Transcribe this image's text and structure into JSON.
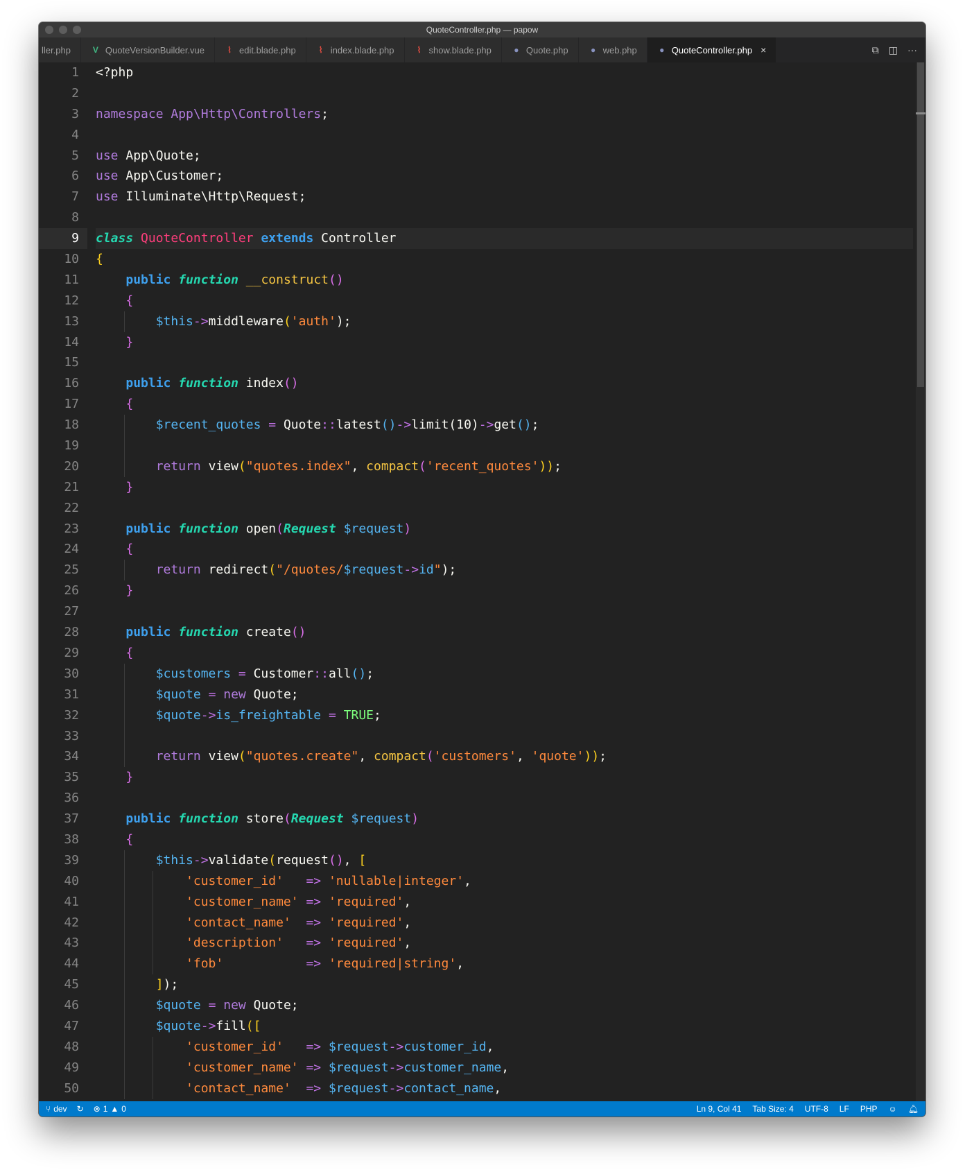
{
  "window": {
    "title": "QuoteController.php — papow"
  },
  "tabs": [
    {
      "label": "ller.php",
      "icon": "php-icon",
      "active": false
    },
    {
      "label": "QuoteVersionBuilder.vue",
      "icon": "vue-icon",
      "active": false
    },
    {
      "label": "edit.blade.php",
      "icon": "laravel-icon",
      "active": false
    },
    {
      "label": "index.blade.php",
      "icon": "laravel-icon",
      "active": false
    },
    {
      "label": "show.blade.php",
      "icon": "laravel-icon",
      "active": false
    },
    {
      "label": "Quote.php",
      "icon": "php-icon",
      "active": false
    },
    {
      "label": "web.php",
      "icon": "php-icon",
      "active": false
    },
    {
      "label": "QuoteController.php",
      "icon": "php-icon",
      "active": true
    }
  ],
  "tab_actions": {
    "close_symbol": "×",
    "more_symbol": "···"
  },
  "editor": {
    "current_line": 9,
    "line_numbers": [
      "1",
      "2",
      "3",
      "4",
      "5",
      "6",
      "7",
      "8",
      "9",
      "10",
      "11",
      "12",
      "13",
      "14",
      "15",
      "16",
      "17",
      "18",
      "19",
      "20",
      "21",
      "22",
      "23",
      "24",
      "25",
      "26",
      "27",
      "28",
      "29",
      "30",
      "31",
      "32",
      "33",
      "34",
      "35",
      "36",
      "37",
      "38",
      "39",
      "40",
      "41",
      "42",
      "43",
      "44",
      "45",
      "46",
      "47",
      "48",
      "49",
      "50"
    ]
  },
  "code": {
    "l1": {
      "a": "<?php"
    },
    "l3": {
      "a": "namespace",
      "b": " App\\Http\\Controllers",
      "c": ";"
    },
    "l5": {
      "a": "use",
      "b": " App\\Quote;"
    },
    "l6": {
      "a": "use",
      "b": " App\\Customer;"
    },
    "l7": {
      "a": "use",
      "b": " Illuminate\\Http\\Request;"
    },
    "l9": {
      "a": "class",
      "b": "QuoteController",
      "c": "extends",
      "d": "Controller"
    },
    "l10": {
      "a": "{"
    },
    "l11": {
      "a": "public",
      "b": "function",
      "c": "__construct",
      "d": "()"
    },
    "l12": {
      "a": "{"
    },
    "l13": {
      "a": "$this",
      "b": "->",
      "c": "middleware",
      "d": "(",
      "e": "'auth'",
      "f": ");"
    },
    "l14": {
      "a": "}"
    },
    "l16": {
      "a": "public",
      "b": "function",
      "c": "index",
      "d": "()"
    },
    "l17": {
      "a": "{"
    },
    "l18": {
      "a": "$recent_quotes",
      "b": " = ",
      "c": "Quote",
      "d": "::",
      "e": "latest",
      "f": "()",
      "g": "->",
      "h": "limit",
      "i": "(10)",
      "j": "->",
      "k": "get",
      "l": "()",
      "m": ";"
    },
    "l20": {
      "a": "return",
      "b": " view",
      "c": "(",
      "d": "\"quotes.index\"",
      "e": ", ",
      "f": "compact",
      "g": "(",
      "h": "'recent_quotes'",
      "i": "))",
      "j": ";"
    },
    "l21": {
      "a": "}"
    },
    "l23": {
      "a": "public",
      "b": "function",
      "c": "open",
      "d": "(",
      "e": "Request",
      "f": "$request",
      "g": ")"
    },
    "l24": {
      "a": "{"
    },
    "l25": {
      "a": "return",
      "b": " redirect",
      "c": "(",
      "d": "\"/quotes/",
      "e": "$request",
      "f": "->",
      "g": "id",
      "h": "\"",
      "i": ");"
    },
    "l26": {
      "a": "}"
    },
    "l28": {
      "a": "public",
      "b": "function",
      "c": "create",
      "d": "()"
    },
    "l29": {
      "a": "{"
    },
    "l30": {
      "a": "$customers",
      "b": " = ",
      "c": "Customer",
      "d": "::",
      "e": "all",
      "f": "()",
      "g": ";"
    },
    "l31": {
      "a": "$quote",
      "b": " = ",
      "c": "new",
      "d": " Quote;"
    },
    "l32": {
      "a": "$quote",
      "b": "->",
      "c": "is_freightable",
      "d": " = ",
      "e": "TRUE",
      "f": ";"
    },
    "l34": {
      "a": "return",
      "b": " view",
      "c": "(",
      "d": "\"quotes.create\"",
      "e": ", ",
      "f": "compact",
      "g": "(",
      "h": "'customers'",
      "i": ", ",
      "j": "'quote'",
      "k": "))",
      "l": ";"
    },
    "l35": {
      "a": "}"
    },
    "l37": {
      "a": "public",
      "b": "function",
      "c": "store",
      "d": "(",
      "e": "Request",
      "f": "$request",
      "g": ")"
    },
    "l38": {
      "a": "{"
    },
    "l39": {
      "a": "$this",
      "b": "->",
      "c": "validate",
      "d": "(",
      "e": "request",
      "f": "()",
      "g": ", ",
      "h": "["
    },
    "l40": {
      "a": "'customer_id'",
      "b": "   => ",
      "c": "'nullable|integer'",
      "d": ","
    },
    "l41": {
      "a": "'customer_name'",
      "b": " => ",
      "c": "'required'",
      "d": ","
    },
    "l42": {
      "a": "'contact_name'",
      "b": "  => ",
      "c": "'required'",
      "d": ","
    },
    "l43": {
      "a": "'description'",
      "b": "   => ",
      "c": "'required'",
      "d": ","
    },
    "l44": {
      "a": "'fob'",
      "b": "           => ",
      "c": "'required|string'",
      "d": ","
    },
    "l45": {
      "a": "]",
      "b": ");"
    },
    "l46": {
      "a": "$quote",
      "b": " = ",
      "c": "new",
      "d": " Quote;"
    },
    "l47": {
      "a": "$quote",
      "b": "->",
      "c": "fill",
      "d": "(",
      "e": "["
    },
    "l48": {
      "a": "'customer_id'",
      "b": "   => ",
      "c": "$request",
      "d": "->",
      "e": "customer_id",
      "f": ","
    },
    "l49": {
      "a": "'customer_name'",
      "b": " => ",
      "c": "$request",
      "d": "->",
      "e": "customer_name",
      "f": ","
    },
    "l50": {
      "a": "'contact_name'",
      "b": "  => ",
      "c": "$request",
      "d": "->",
      "e": "contact_name",
      "f": ","
    }
  },
  "statusbar": {
    "branch": "dev",
    "errors": "1",
    "warnings": "0",
    "position": "Ln 9, Col 41",
    "tab_size": "Tab Size: 4",
    "encoding": "UTF-8",
    "eol": "LF",
    "language": "PHP"
  },
  "colors": {
    "editor_bg": "#222222",
    "statusbar_bg": "#007acc",
    "tab_active_bg": "#1e1e1e"
  }
}
